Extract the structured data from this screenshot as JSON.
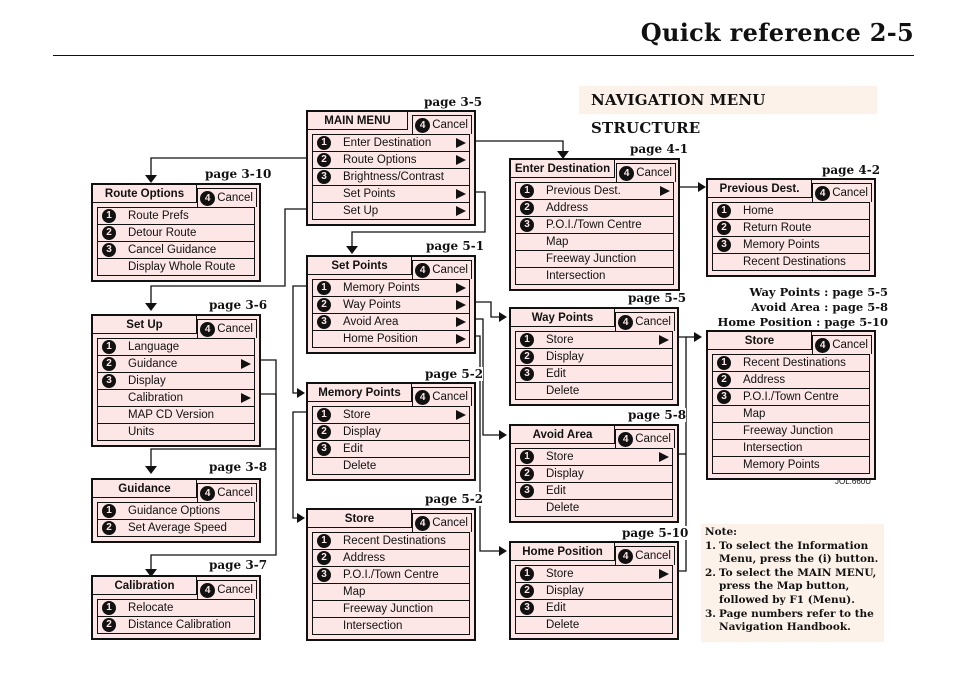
{
  "header": {
    "title": "Quick reference   2-5"
  },
  "section_title": "NAVIGATION MENU STRUCTURE",
  "cancel_label": "Cancel",
  "cancel_number": "4",
  "menus": {
    "main_menu": {
      "title": "MAIN MENU",
      "page": "page 3-5",
      "items": [
        {
          "num": "1",
          "label": "Enter Destination",
          "submenu": true
        },
        {
          "num": "2",
          "label": "Route Options",
          "submenu": true
        },
        {
          "num": "3",
          "label": "Brightness/Contrast",
          "submenu": false
        },
        {
          "num": "",
          "label": "Set Points",
          "submenu": true
        },
        {
          "num": "",
          "label": "Set Up",
          "submenu": true
        }
      ]
    },
    "route_options": {
      "title": "Route Options",
      "page": "page 3-10",
      "items": [
        {
          "num": "1",
          "label": "Route Prefs"
        },
        {
          "num": "2",
          "label": "Detour Route"
        },
        {
          "num": "3",
          "label": "Cancel Guidance"
        },
        {
          "num": "",
          "label": "Display Whole Route"
        }
      ]
    },
    "enter_destination": {
      "title": "Enter Destination",
      "page": "page 4-1",
      "items": [
        {
          "num": "1",
          "label": "Previous Dest.",
          "submenu": true
        },
        {
          "num": "2",
          "label": "Address"
        },
        {
          "num": "3",
          "label": "P.O.I./Town Centre"
        },
        {
          "num": "",
          "label": "Map"
        },
        {
          "num": "",
          "label": "Freeway Junction"
        },
        {
          "num": "",
          "label": "Intersection"
        }
      ]
    },
    "previous_dest": {
      "title": "Previous Dest.",
      "page": "page 4-2",
      "items": [
        {
          "num": "1",
          "label": "Home"
        },
        {
          "num": "2",
          "label": "Return Route"
        },
        {
          "num": "3",
          "label": "Memory Points"
        },
        {
          "num": "",
          "label": "Recent Destinations"
        }
      ]
    },
    "set_points": {
      "title": "Set Points",
      "page": "page 5-1",
      "items": [
        {
          "num": "1",
          "label": "Memory Points",
          "submenu": true
        },
        {
          "num": "2",
          "label": "Way Points",
          "submenu": true
        },
        {
          "num": "3",
          "label": "Avoid Area",
          "submenu": true
        },
        {
          "num": "",
          "label": "Home Position",
          "submenu": true
        }
      ]
    },
    "set_up": {
      "title": "Set Up",
      "page": "page 3-6",
      "items": [
        {
          "num": "1",
          "label": "Language"
        },
        {
          "num": "2",
          "label": "Guidance",
          "submenu": true
        },
        {
          "num": "3",
          "label": "Display"
        },
        {
          "num": "",
          "label": "Calibration",
          "submenu": true
        },
        {
          "num": "",
          "label": "MAP CD Version"
        },
        {
          "num": "",
          "label": "Units"
        }
      ]
    },
    "memory_points": {
      "title": "Memory Points",
      "page": "page 5-2",
      "items": [
        {
          "num": "1",
          "label": "Store",
          "submenu": true
        },
        {
          "num": "2",
          "label": "Display"
        },
        {
          "num": "3",
          "label": "Edit"
        },
        {
          "num": "",
          "label": "Delete"
        }
      ]
    },
    "way_points": {
      "title": "Way Points",
      "page": "page 5-5",
      "items": [
        {
          "num": "1",
          "label": "Store",
          "submenu": true
        },
        {
          "num": "2",
          "label": "Display"
        },
        {
          "num": "3",
          "label": "Edit"
        },
        {
          "num": "",
          "label": "Delete"
        }
      ]
    },
    "avoid_area": {
      "title": "Avoid Area",
      "page": "page 5-8",
      "items": [
        {
          "num": "1",
          "label": "Store",
          "submenu": true
        },
        {
          "num": "2",
          "label": "Display"
        },
        {
          "num": "3",
          "label": "Edit"
        },
        {
          "num": "",
          "label": "Delete"
        }
      ]
    },
    "home_position": {
      "title": "Home Position",
      "page": "page 5-10",
      "items": [
        {
          "num": "1",
          "label": "Store",
          "submenu": true
        },
        {
          "num": "2",
          "label": "Display"
        },
        {
          "num": "3",
          "label": "Edit"
        },
        {
          "num": "",
          "label": "Delete"
        }
      ]
    },
    "guidance": {
      "title": "Guidance",
      "page": "page 3-8",
      "items": [
        {
          "num": "1",
          "label": "Guidance Options"
        },
        {
          "num": "2",
          "label": "Set Average Speed"
        }
      ]
    },
    "calibration": {
      "title": "Calibration",
      "page": "page 3-7",
      "items": [
        {
          "num": "1",
          "label": "Relocate"
        },
        {
          "num": "2",
          "label": "Distance Calibration"
        }
      ]
    },
    "store_memory": {
      "title": "Store",
      "page": "page 5-2",
      "items": [
        {
          "num": "1",
          "label": "Recent Destinations"
        },
        {
          "num": "2",
          "label": "Address"
        },
        {
          "num": "3",
          "label": "P.O.I./Town Centre"
        },
        {
          "num": "",
          "label": "Map"
        },
        {
          "num": "",
          "label": "Freeway Junction"
        },
        {
          "num": "",
          "label": "Intersection"
        }
      ]
    },
    "store_points": {
      "title": "Store",
      "page": "",
      "items": [
        {
          "num": "1",
          "label": "Recent Destinations"
        },
        {
          "num": "2",
          "label": "Address"
        },
        {
          "num": "3",
          "label": "P.O.I./Town Centre"
        },
        {
          "num": "",
          "label": "Map"
        },
        {
          "num": "",
          "label": "Freeway Junction"
        },
        {
          "num": "",
          "label": "Intersection"
        },
        {
          "num": "",
          "label": "Memory Points"
        }
      ]
    }
  },
  "store_legend": [
    "Way Points : page 5-5",
    "Avoid Area : page 5-8",
    "Home Position : page 5-10"
  ],
  "figure_code": "JOL.660U",
  "note": {
    "heading": "Note:",
    "items": [
      {
        "n": "1.",
        "text": "To select the Information Menu, press the (i) button."
      },
      {
        "n": "2.",
        "text": "To select the MAIN MENU, press the Map button, followed by F1 (Menu)."
      },
      {
        "n": "3.",
        "text": "Page numbers refer to the Navigation Handbook."
      }
    ]
  }
}
